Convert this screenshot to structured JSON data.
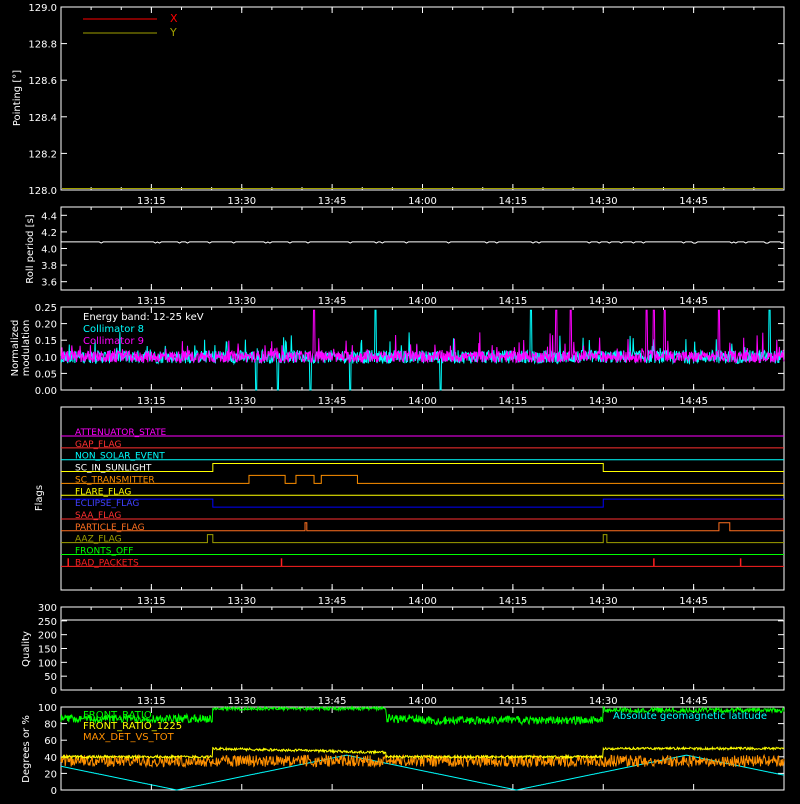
{
  "x_tick_labels": [
    "13:15",
    "13:30",
    "13:45",
    "14:00",
    "14:15",
    "14:30",
    "14:45"
  ],
  "chart_data": [
    {
      "type": "line",
      "panel": "pointing",
      "ylabel": "Pointing [°]",
      "ylim": [
        128.0,
        129.0
      ],
      "y_ticks": [
        "128.0",
        "128.2",
        "128.4",
        "128.6",
        "128.8",
        "129.0"
      ],
      "x_ticks": [
        "13:15",
        "13:30",
        "13:45",
        "14:00",
        "14:15",
        "14:30",
        "14:45"
      ],
      "series": [
        {
          "name": "X",
          "color": "#ff0000",
          "y": 128.0
        },
        {
          "name": "Y",
          "color": "#a0a000",
          "y": 128.0
        }
      ]
    },
    {
      "type": "line",
      "panel": "roll",
      "ylabel": "Roll period [s]",
      "ylim": [
        3.5,
        4.5
      ],
      "y_ticks": [
        "3.6",
        "3.8",
        "4.0",
        "4.2",
        "4.4"
      ],
      "series": [
        {
          "color": "#ffffff",
          "y": 4.08
        }
      ]
    },
    {
      "type": "line",
      "panel": "modulation",
      "ylabel_lines": [
        "Normalized",
        "modulation"
      ],
      "ylim": [
        0.0,
        0.25
      ],
      "y_ticks": [
        "0.00",
        "0.05",
        "0.10",
        "0.15",
        "0.20",
        "0.25"
      ],
      "annotation": "Energy band: 12-25 keV",
      "series": [
        {
          "name": "Collimator 8",
          "color": "#00ffff",
          "baseline": 0.1
        },
        {
          "name": "Collimator 9",
          "color": "#ff00ff",
          "baseline": 0.1
        }
      ]
    },
    {
      "type": "line",
      "panel": "flags",
      "ylabel": "Flags",
      "flags": [
        {
          "name": "ATTENUATOR_STATE",
          "color": "#ff00ff",
          "label_color": "#ff00ff"
        },
        {
          "name": "GAP_FLAG",
          "color": "#ff3030",
          "label_color": "#ff3030"
        },
        {
          "name": "NON_SOLAR_EVENT",
          "color": "#00ffff",
          "label_color": "#00ffff"
        },
        {
          "name": "SC_IN_SUNLIGHT",
          "color": "#ffff00",
          "label_color": "#ffffff",
          "high": [
            [
              13.42,
              14.5
            ]
          ]
        },
        {
          "name": "SC_TRANSMITTER",
          "color": "#ff9000",
          "label_color": "#ff9000",
          "high": [
            [
              13.52,
              13.62
            ],
            [
              13.65,
              13.7
            ],
            [
              13.72,
              13.82
            ]
          ]
        },
        {
          "name": "FLARE_FLAG",
          "color": "#ffff00",
          "label_color": "#ffff00"
        },
        {
          "name": "ECLIPSE_FLAG",
          "color": "#0000ff",
          "label_color": "#4040ff",
          "high": [
            [
              13.0,
              13.42
            ],
            [
              14.5,
              15.0
            ]
          ]
        },
        {
          "name": "SAA_FLAG",
          "color": "#ff3030",
          "label_color": "#ff3030"
        },
        {
          "name": "PARTICLE_FLAG",
          "color": "#ff7020",
          "label_color": "#ff7020",
          "high": [
            [
              13.675,
              13.68
            ],
            [
              14.82,
              14.85
            ]
          ]
        },
        {
          "name": "AAZ_FLAG",
          "color": "#a0a000",
          "label_color": "#a0a000",
          "high": [
            [
              13.405,
              13.42
            ],
            [
              14.5,
              14.51
            ]
          ]
        },
        {
          "name": "FRONTS_OFF",
          "color": "#00ff00",
          "label_color": "#00ff00"
        },
        {
          "name": "BAD_PACKETS",
          "color": "#ff2020",
          "label_color": "#ff2020",
          "spikes": [
            13.02,
            13.61,
            14.64,
            14.88
          ]
        }
      ]
    },
    {
      "type": "line",
      "panel": "quality",
      "ylabel": "Quality",
      "ylim": [
        0,
        300
      ],
      "y_ticks": [
        "0",
        "50",
        "100",
        "150",
        "200",
        "250",
        "300"
      ],
      "series": [
        {
          "color": "#ffffff",
          "y": 300
        }
      ]
    },
    {
      "type": "line",
      "panel": "fronts",
      "ylabel": "Degrees or %",
      "ylim": [
        0,
        100
      ],
      "y_ticks": [
        "0",
        "20",
        "40",
        "60",
        "80",
        "100"
      ],
      "annotation": "Absolute geomagnetic latitude",
      "series": [
        {
          "name": "FRONT_RATIO",
          "color": "#00ff00"
        },
        {
          "name": "FRONT_RATIO_1225",
          "color": "#ffff00"
        },
        {
          "name": "MAX_DET_VS_TOT",
          "color": "#ff9000"
        },
        {
          "name": "Absolute geomagnetic latitude",
          "color": "#00ffff"
        }
      ]
    }
  ]
}
